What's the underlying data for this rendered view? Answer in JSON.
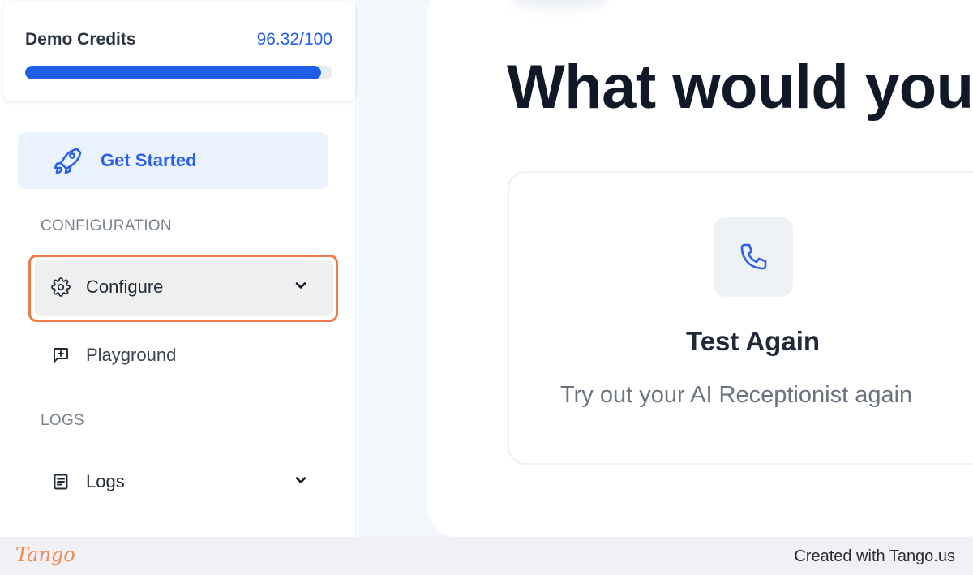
{
  "sidebar": {
    "credits": {
      "label": "Demo Credits",
      "value_text": "96.32/100",
      "fraction": 0.9632
    },
    "get_started": {
      "label": "Get Started",
      "icon": "rocket-icon"
    },
    "sections": {
      "configuration": "CONFIGURATION",
      "logs": "LOGS"
    },
    "items": {
      "configure": {
        "label": "Configure",
        "icon": "gear-icon",
        "expandable": true,
        "highlighted": true
      },
      "playground": {
        "label": "Playground",
        "icon": "chat-plus-icon"
      },
      "logs": {
        "label": "Logs",
        "icon": "document-icon",
        "expandable": true
      }
    }
  },
  "main": {
    "title": "What would you",
    "card": {
      "icon": "phone-icon",
      "title": "Test Again",
      "subtitle": "Try out your AI Receptionist again"
    }
  },
  "footer": {
    "logo": "Tango",
    "text": "Created with Tango.us"
  },
  "colors": {
    "accent": "#2a5fe6",
    "highlight_outline": "#f07a4d",
    "active_bg": "#eaf3fd"
  }
}
